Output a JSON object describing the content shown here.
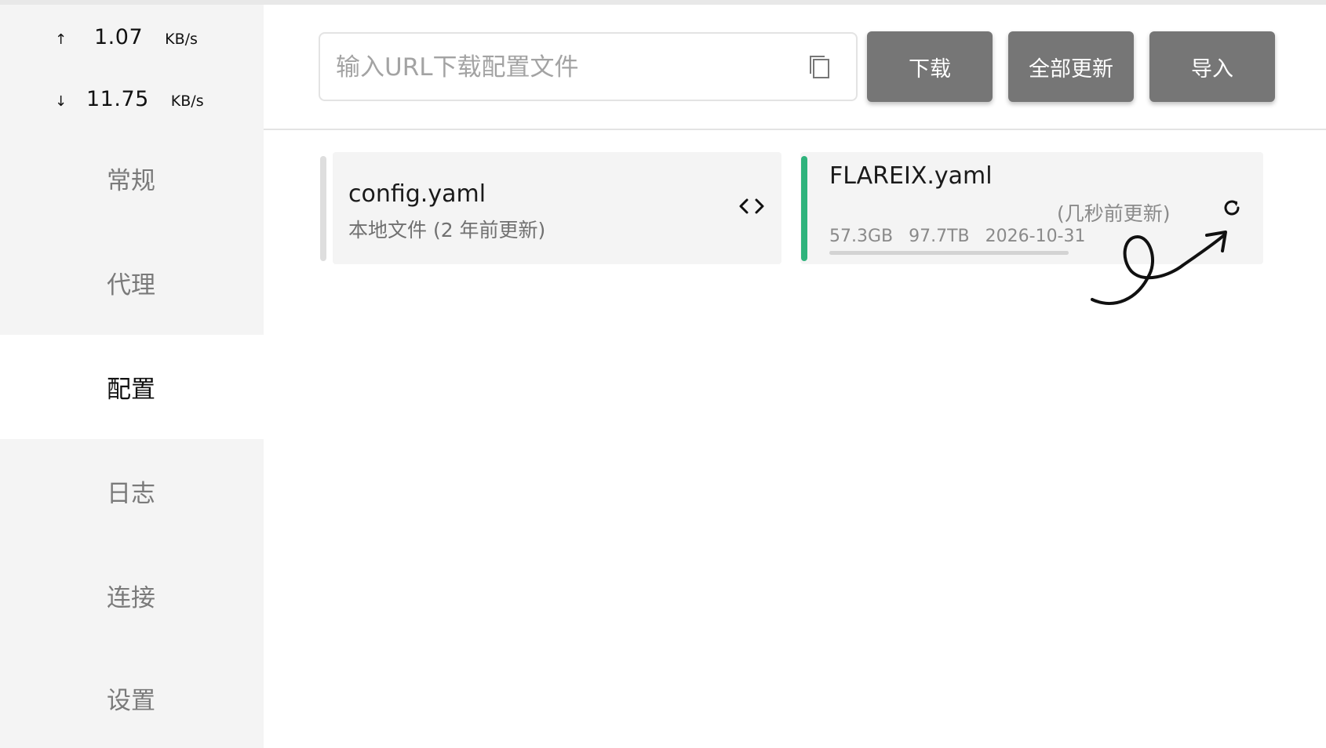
{
  "traffic": {
    "up": {
      "arrow": "↑",
      "value": "1.07",
      "unit": "KB/s"
    },
    "down": {
      "arrow": "↓",
      "value": "11.75",
      "unit": "KB/s"
    }
  },
  "nav": {
    "items": [
      {
        "label": "常规"
      },
      {
        "label": "代理"
      },
      {
        "label": "配置",
        "active": true
      },
      {
        "label": "日志"
      },
      {
        "label": "连接"
      },
      {
        "label": "设置"
      }
    ]
  },
  "toolbar": {
    "url_placeholder": "输入URL下载配置文件",
    "download_label": "下载",
    "update_all_label": "全部更新",
    "import_label": "导入"
  },
  "profiles": [
    {
      "name": "config.yaml",
      "subtitle": "本地文件 (2 年前更新)",
      "selected": false
    },
    {
      "name": "FLAREIX.yaml",
      "updated": "(几秒前更新)",
      "used": "57.3GB",
      "total": "97.7TB",
      "expire": "2026-10-31",
      "usage_fraction": 0.0006,
      "selected": true
    }
  ],
  "colors": {
    "accent": "#2fb37c",
    "button": "#767676",
    "sidebar_bg": "#f4f4f4"
  },
  "icons": [
    "paste-icon",
    "code-icon",
    "refresh-icon"
  ]
}
